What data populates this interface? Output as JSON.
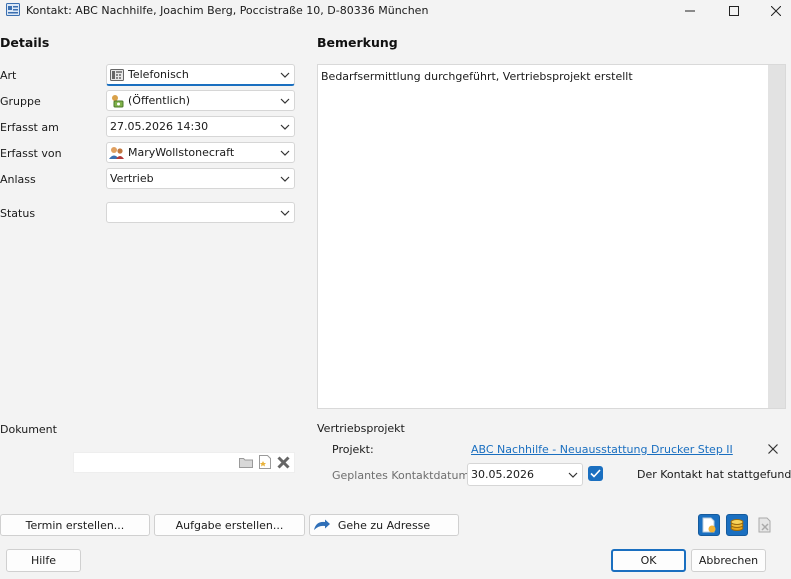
{
  "window": {
    "title": "Kontakt: ABC Nachhilfe, Joachim Berg, Poccistraße 10, D-80336 München",
    "minimize_icon": "minimize-icon",
    "maximize_icon": "maximize-icon",
    "close_icon": "close-icon"
  },
  "details": {
    "heading": "Details",
    "art": {
      "label": "Art",
      "value": "Telefonisch",
      "icon": "phone-icon"
    },
    "gruppe": {
      "label": "Gruppe",
      "value": "(Öffentlich)",
      "icon": "group-icon"
    },
    "erfasst_am": {
      "label": "Erfasst am",
      "value": "27.05.2026 14:30"
    },
    "erfasst_von": {
      "label": "Erfasst von",
      "value": "MaryWollstonecraft",
      "icon": "users-icon"
    },
    "anlass": {
      "label": "Anlass",
      "value": "Vertrieb"
    },
    "status": {
      "label": "Status",
      "value": ""
    }
  },
  "remarks": {
    "heading": "Bemerkung",
    "text": "Bedarfsermittlung durchgeführt, Vertriebsprojekt erstellt"
  },
  "document": {
    "label": "Dokument",
    "value": ""
  },
  "sales_project": {
    "heading": "Vertriebsprojekt",
    "project_label": "Projekt:",
    "project_link": "ABC Nachhilfe - Neuausstattung Drucker Step II",
    "planned_date_label": "Geplantes Kontaktdatum:",
    "planned_date_value": "30.05.2026",
    "took_place_checked": true,
    "took_place_label": "Der Kontakt hat stattgefunden"
  },
  "actions": {
    "termin": "Termin erstellen...",
    "aufgabe": "Aufgabe erstellen...",
    "adresse": "Gehe zu Adresse"
  },
  "footer": {
    "help": "Hilfe",
    "ok": "OK",
    "cancel": "Abbrechen"
  },
  "colors": {
    "accent": "#1a6fc0",
    "background": "#f3f3f3"
  }
}
